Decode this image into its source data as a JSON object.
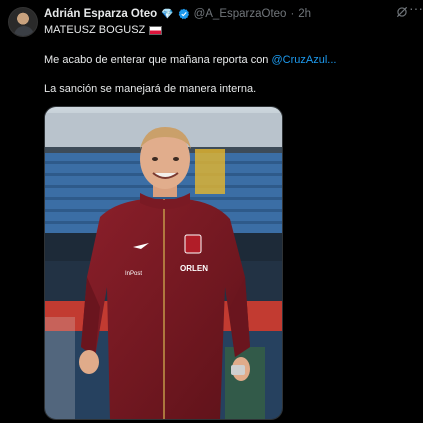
{
  "tweet": {
    "author_name": "Adrián Esparza Oteo",
    "badge_emoji": "💎",
    "handle": "@A_EsparzaOteo",
    "separator": "·",
    "time": "2h",
    "line1": "MATEUSZ BOGUSZ",
    "line2_prefix": "Me acabo de enterar que mañana reporta con ",
    "line2_link": "@CruzAzul...",
    "line3": "La sanción se manejará de manera interna.",
    "jersey_sponsor": "ORLEN",
    "jersey_brand_text": "InPost"
  },
  "colors": {
    "link": "#1d9bf0",
    "verified": "#1d9bf0",
    "text": "#e7e9ea",
    "muted": "#71767b",
    "jersey": "#7a1a24"
  },
  "icons": [
    "verified-icon",
    "grok-icon",
    "more-icon",
    "poland-flag-icon"
  ]
}
